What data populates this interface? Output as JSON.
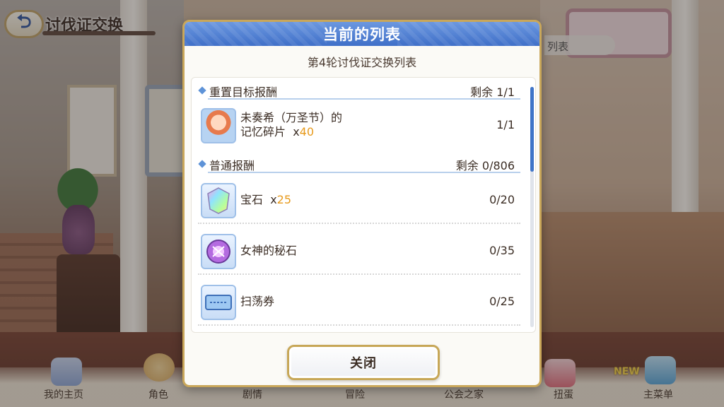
{
  "header": {
    "title": "讨伐证交换",
    "back_icon": "back-arrow-icon"
  },
  "background": {
    "side_label": "列表"
  },
  "modal": {
    "title": "当前的列表",
    "subtitle": "第4轮讨伐证交换列表",
    "sections": [
      {
        "name": "重置目标报酬",
        "remaining": "剩余  1/1",
        "items": [
          {
            "name_line1": "未奏希（万圣节）的",
            "name_line2": "记忆碎片",
            "qty": "40",
            "count": "1/1",
            "icon": "character-portrait-icon"
          }
        ]
      },
      {
        "name": "普通报酬",
        "remaining": "剩余  0/806",
        "items": [
          {
            "name": "宝石",
            "qty": "25",
            "count": "0/20",
            "icon": "gem-icon"
          },
          {
            "name": "女神的秘石",
            "qty": "",
            "count": "0/35",
            "icon": "goddess-stone-icon"
          },
          {
            "name": "扫荡券",
            "qty": "",
            "count": "0/25",
            "icon": "sweep-ticket-icon"
          }
        ]
      }
    ],
    "close_label": "关闭"
  },
  "nav": {
    "items": [
      {
        "label": "我的主页"
      },
      {
        "label": "角色"
      },
      {
        "label": "剧情"
      },
      {
        "label": "冒险"
      },
      {
        "label": "公会之家"
      },
      {
        "label": "扭蛋"
      },
      {
        "label": "主菜单"
      }
    ],
    "new_badge": "NEW"
  },
  "colors": {
    "accent_blue": "#3f6fc8",
    "gold_border": "#c9a75a",
    "qty_orange": "#e79a1c"
  }
}
